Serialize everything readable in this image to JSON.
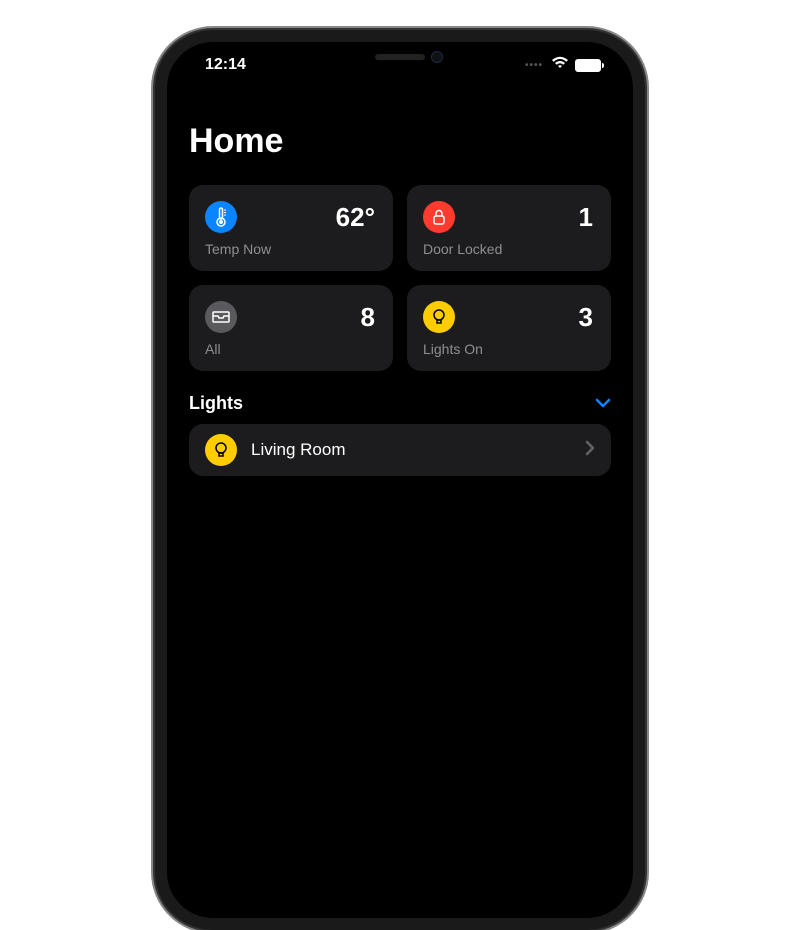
{
  "status": {
    "time": "12:14"
  },
  "page": {
    "title": "Home"
  },
  "tiles": [
    {
      "icon": "thermometer",
      "color": "#0a84ff",
      "value": "62°",
      "label": "Temp Now"
    },
    {
      "icon": "lock",
      "color": "#ff3b30",
      "value": "1",
      "label": "Door Locked"
    },
    {
      "icon": "inbox",
      "color": "#5a5a5e",
      "value": "8",
      "label": "All"
    },
    {
      "icon": "bulb",
      "color": "#ffcc00",
      "value": "3",
      "label": "Lights On"
    }
  ],
  "section": {
    "title": "Lights"
  },
  "lights": [
    {
      "name": "Living Room",
      "icon": "bulb",
      "color": "#ffcc00"
    }
  ]
}
